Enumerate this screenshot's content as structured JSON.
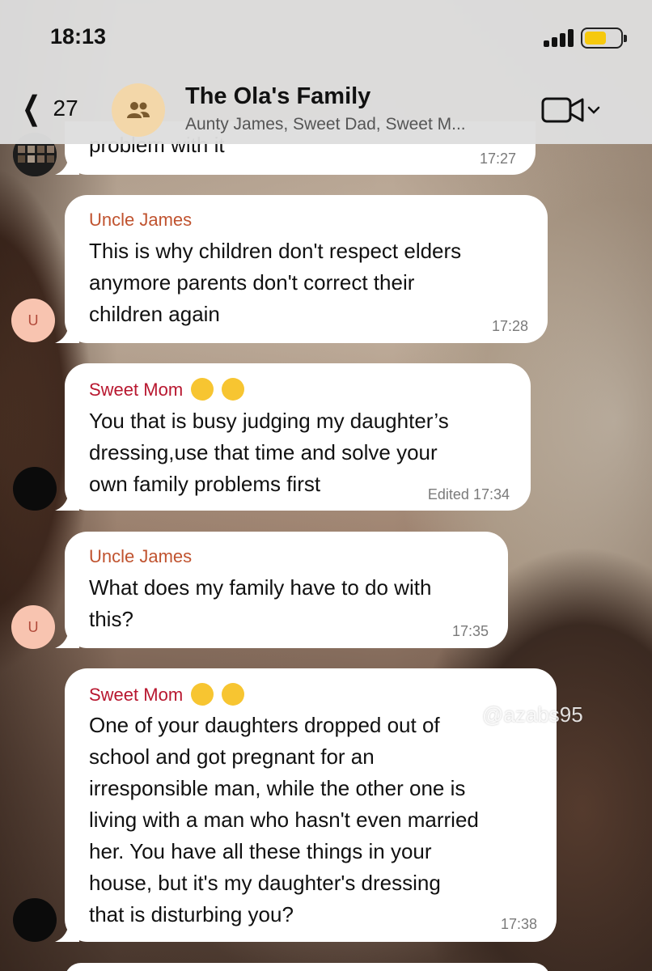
{
  "status_bar": {
    "time": "18:13"
  },
  "header": {
    "back_count": "27",
    "title": "The Ola's Family",
    "subtitle": "Aunty James, Sweet Dad, Sweet M..."
  },
  "messages": [
    {
      "text": "problem with it",
      "time": "17:27"
    },
    {
      "sender": "Uncle James",
      "avatar_letter": "U",
      "text": "This is why children don't respect elders\nanymore parents don't correct their\nchildren again",
      "time": "17:28"
    },
    {
      "sender": "Sweet Mom",
      "text": "You that is busy judging my daughter’s\ndressing,use that time and solve your\nown family problems first",
      "time": "Edited 17:34"
    },
    {
      "sender": "Uncle James",
      "avatar_letter": "U",
      "text": "What does my family have to do with\nthis?",
      "time": "17:35"
    },
    {
      "sender": "Sweet Mom",
      "text": "One of your daughters dropped out of\nschool and got pregnant for an\nirresponsible man, while the other one is\nliving with a man who hasn't even married\nher. You have all these things in your\nhouse, but it's my daughter's dressing\nthat is disturbing you?",
      "time": "17:38"
    }
  ],
  "watermark": "@azabs95",
  "colors": {
    "uncle_name": "#c0532f",
    "mom_name": "#b8172f",
    "bubble": "#ffffff",
    "header_bg": "#dedede"
  },
  "icons": [
    "back-chevron-icon",
    "group-icon",
    "video-camera-icon",
    "signal-icon",
    "battery-icon",
    "shushing-face-emoji",
    "heart-eyes-emoji"
  ]
}
